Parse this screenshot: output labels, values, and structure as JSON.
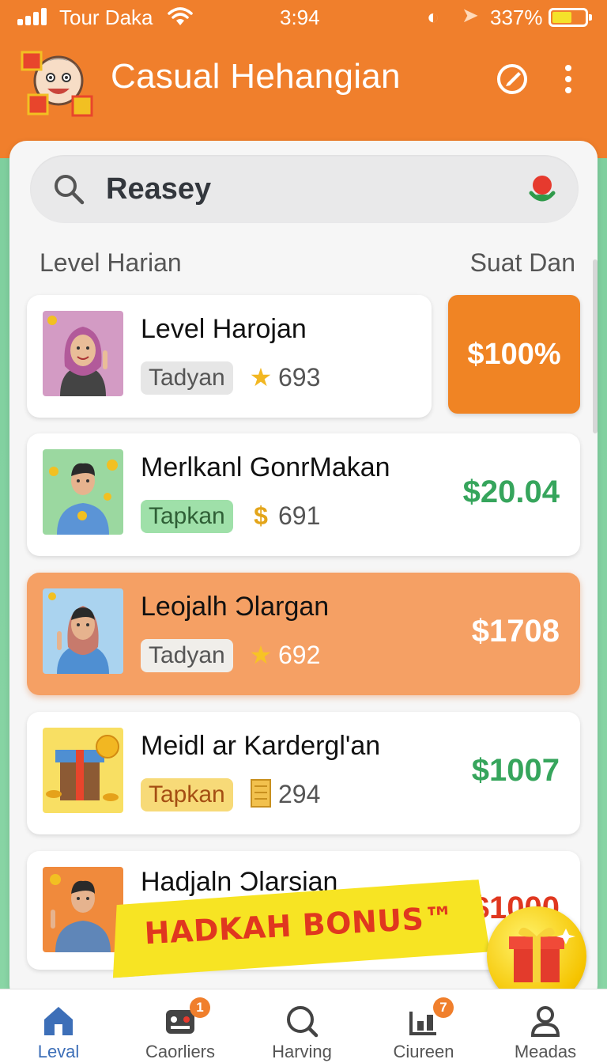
{
  "status_bar": {
    "carrier": "Tour Daka",
    "time": "3:94",
    "battery": "337%"
  },
  "header": {
    "title": "Casual Hehangian",
    "logo_icon": "mascot-gifts-icon",
    "edit_icon": "edit-circle-icon",
    "more_icon": "more-vertical-icon"
  },
  "search": {
    "value": "Reasey",
    "mic_icon": "mic-icon"
  },
  "list": {
    "title": "Level Harian",
    "right_label": "Suat Dan",
    "rows": [
      {
        "name": "Level Harojan",
        "tag": "Tadyan",
        "meta_icon": "star-icon",
        "meta": "693",
        "price": "$100%"
      },
      {
        "name": "Merlkanl GonrMakan",
        "tag": "Tapkan",
        "meta_icon": "dollar-icon",
        "meta": "691",
        "price": "$20.04"
      },
      {
        "name": "Leojalh Ɔlargan",
        "tag": "Tadyan",
        "meta_icon": "star-icon",
        "meta": "692",
        "price": "$1708"
      },
      {
        "name": "Meidl ar Kardergl'an",
        "tag": "Tapkan",
        "meta_icon": "coin-stack-icon",
        "meta": "294",
        "price": "$1007"
      },
      {
        "name": "Hadjaln Ɔlarsian",
        "price": "$1000"
      }
    ]
  },
  "bonus": {
    "label": "HADKAH BONUS™"
  },
  "bottom_nav": [
    {
      "label": "Leval",
      "icon": "home-icon",
      "badge": ""
    },
    {
      "label": "Caorliers",
      "icon": "games-icon",
      "badge": "1"
    },
    {
      "label": "Harving",
      "icon": "search-icon",
      "badge": ""
    },
    {
      "label": "Ciureen",
      "icon": "leaderboard-icon",
      "badge": "7"
    },
    {
      "label": "Meadas",
      "icon": "profile-icon",
      "badge": ""
    }
  ],
  "colors": {
    "brand_orange": "#f07f2c",
    "accent_green": "#36a55c",
    "highlight_row": "#f5a064",
    "bonus_yellow": "#f7e423",
    "bonus_red": "#e0371f"
  }
}
